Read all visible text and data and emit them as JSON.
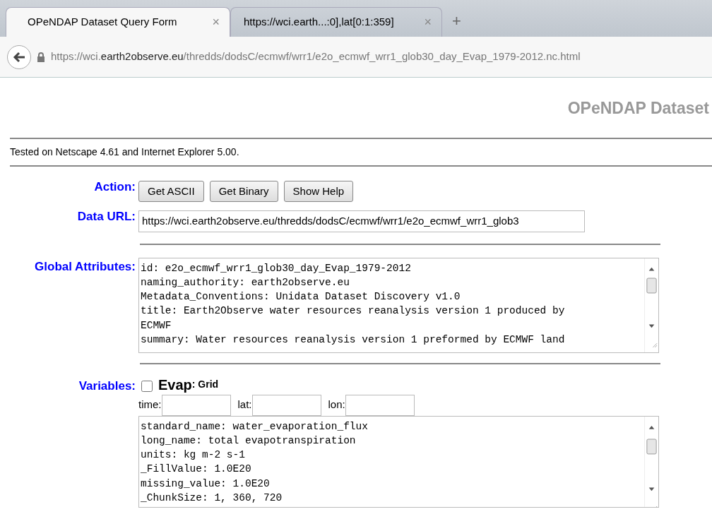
{
  "browser": {
    "tabs": [
      {
        "label": "OPeNDAP Dataset Query Form",
        "close": "×",
        "selected": true
      },
      {
        "label": "https://wci.earth...:0],lat[0:1:359]",
        "close": "×",
        "selected": false
      }
    ],
    "new_tab": "+",
    "address": {
      "prefix": "https://wci.",
      "domain": "earth2observe.eu",
      "path": "/thredds/dodsC/ecmwf/wrr1/e2o_ecmwf_wrr1_glob30_day_Evap_1979-2012.nc.html"
    }
  },
  "page": {
    "heading": "OPeNDAP Dataset",
    "note": "Tested on Netscape 4.61 and Internet Explorer 5.00.",
    "action": {
      "label": "Action:",
      "buttons": [
        "Get ASCII",
        "Get Binary",
        "Show Help"
      ]
    },
    "data_url": {
      "label": "Data URL:",
      "value": "https://wci.earth2observe.eu/thredds/dodsC/ecmwf/wrr1/e2o_ecmwf_wrr1_glob3"
    },
    "global_attributes": {
      "label": "Global Attributes:",
      "lines": [
        "id: e2o_ecmwf_wrr1_glob30_day_Evap_1979-2012",
        "naming_authority: earth2observe.eu",
        "Metadata_Conventions: Unidata Dataset Discovery v1.0",
        "title: Earth2Observe water resources reanalysis version 1 produced by",
        "ECMWF",
        "summary: Water resources reanalysis version 1 preformed by ECMWF land"
      ]
    },
    "variables": {
      "label": "Variables:",
      "items": [
        {
          "name": "Evap",
          "type": ": Grid",
          "checked": false,
          "dims": [
            {
              "label": "time:"
            },
            {
              "label": "lat:"
            },
            {
              "label": "lon:"
            }
          ],
          "lines": [
            "standard_name: water_evaporation_flux",
            "long_name: total evapotranspiration",
            "units: kg m-2 s-1",
            "_FillValue: 1.0E20",
            "missing_value: 1.0E20",
            "_ChunkSize: 1, 360, 720"
          ]
        }
      ]
    }
  }
}
